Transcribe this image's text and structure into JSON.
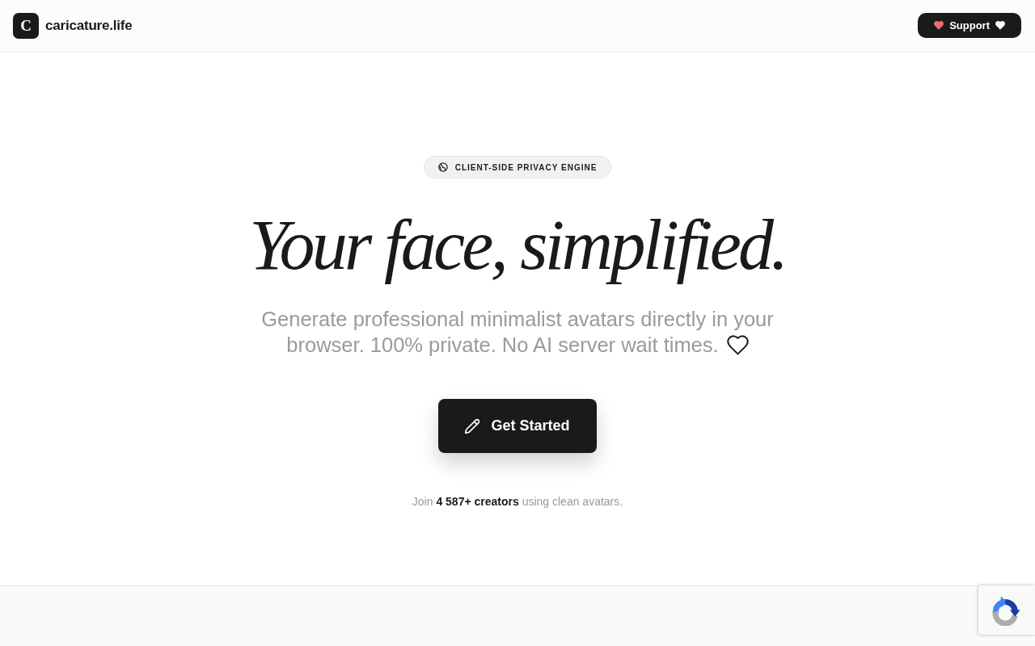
{
  "header": {
    "logo_letter": "C",
    "brand": "caricature.life",
    "support_button": "Support"
  },
  "hero": {
    "badge": "CLIENT-SIDE PRIVACY ENGINE",
    "title": "Your face, simplified.",
    "subtitle_lines": [
      "Generate professional minimalist avatars directly in your",
      "browser. 100% private. No AI server wait times."
    ],
    "cta_button": "Get Started",
    "social_proof": "Join **4 587+ creators** using clean avatars."
  }
}
